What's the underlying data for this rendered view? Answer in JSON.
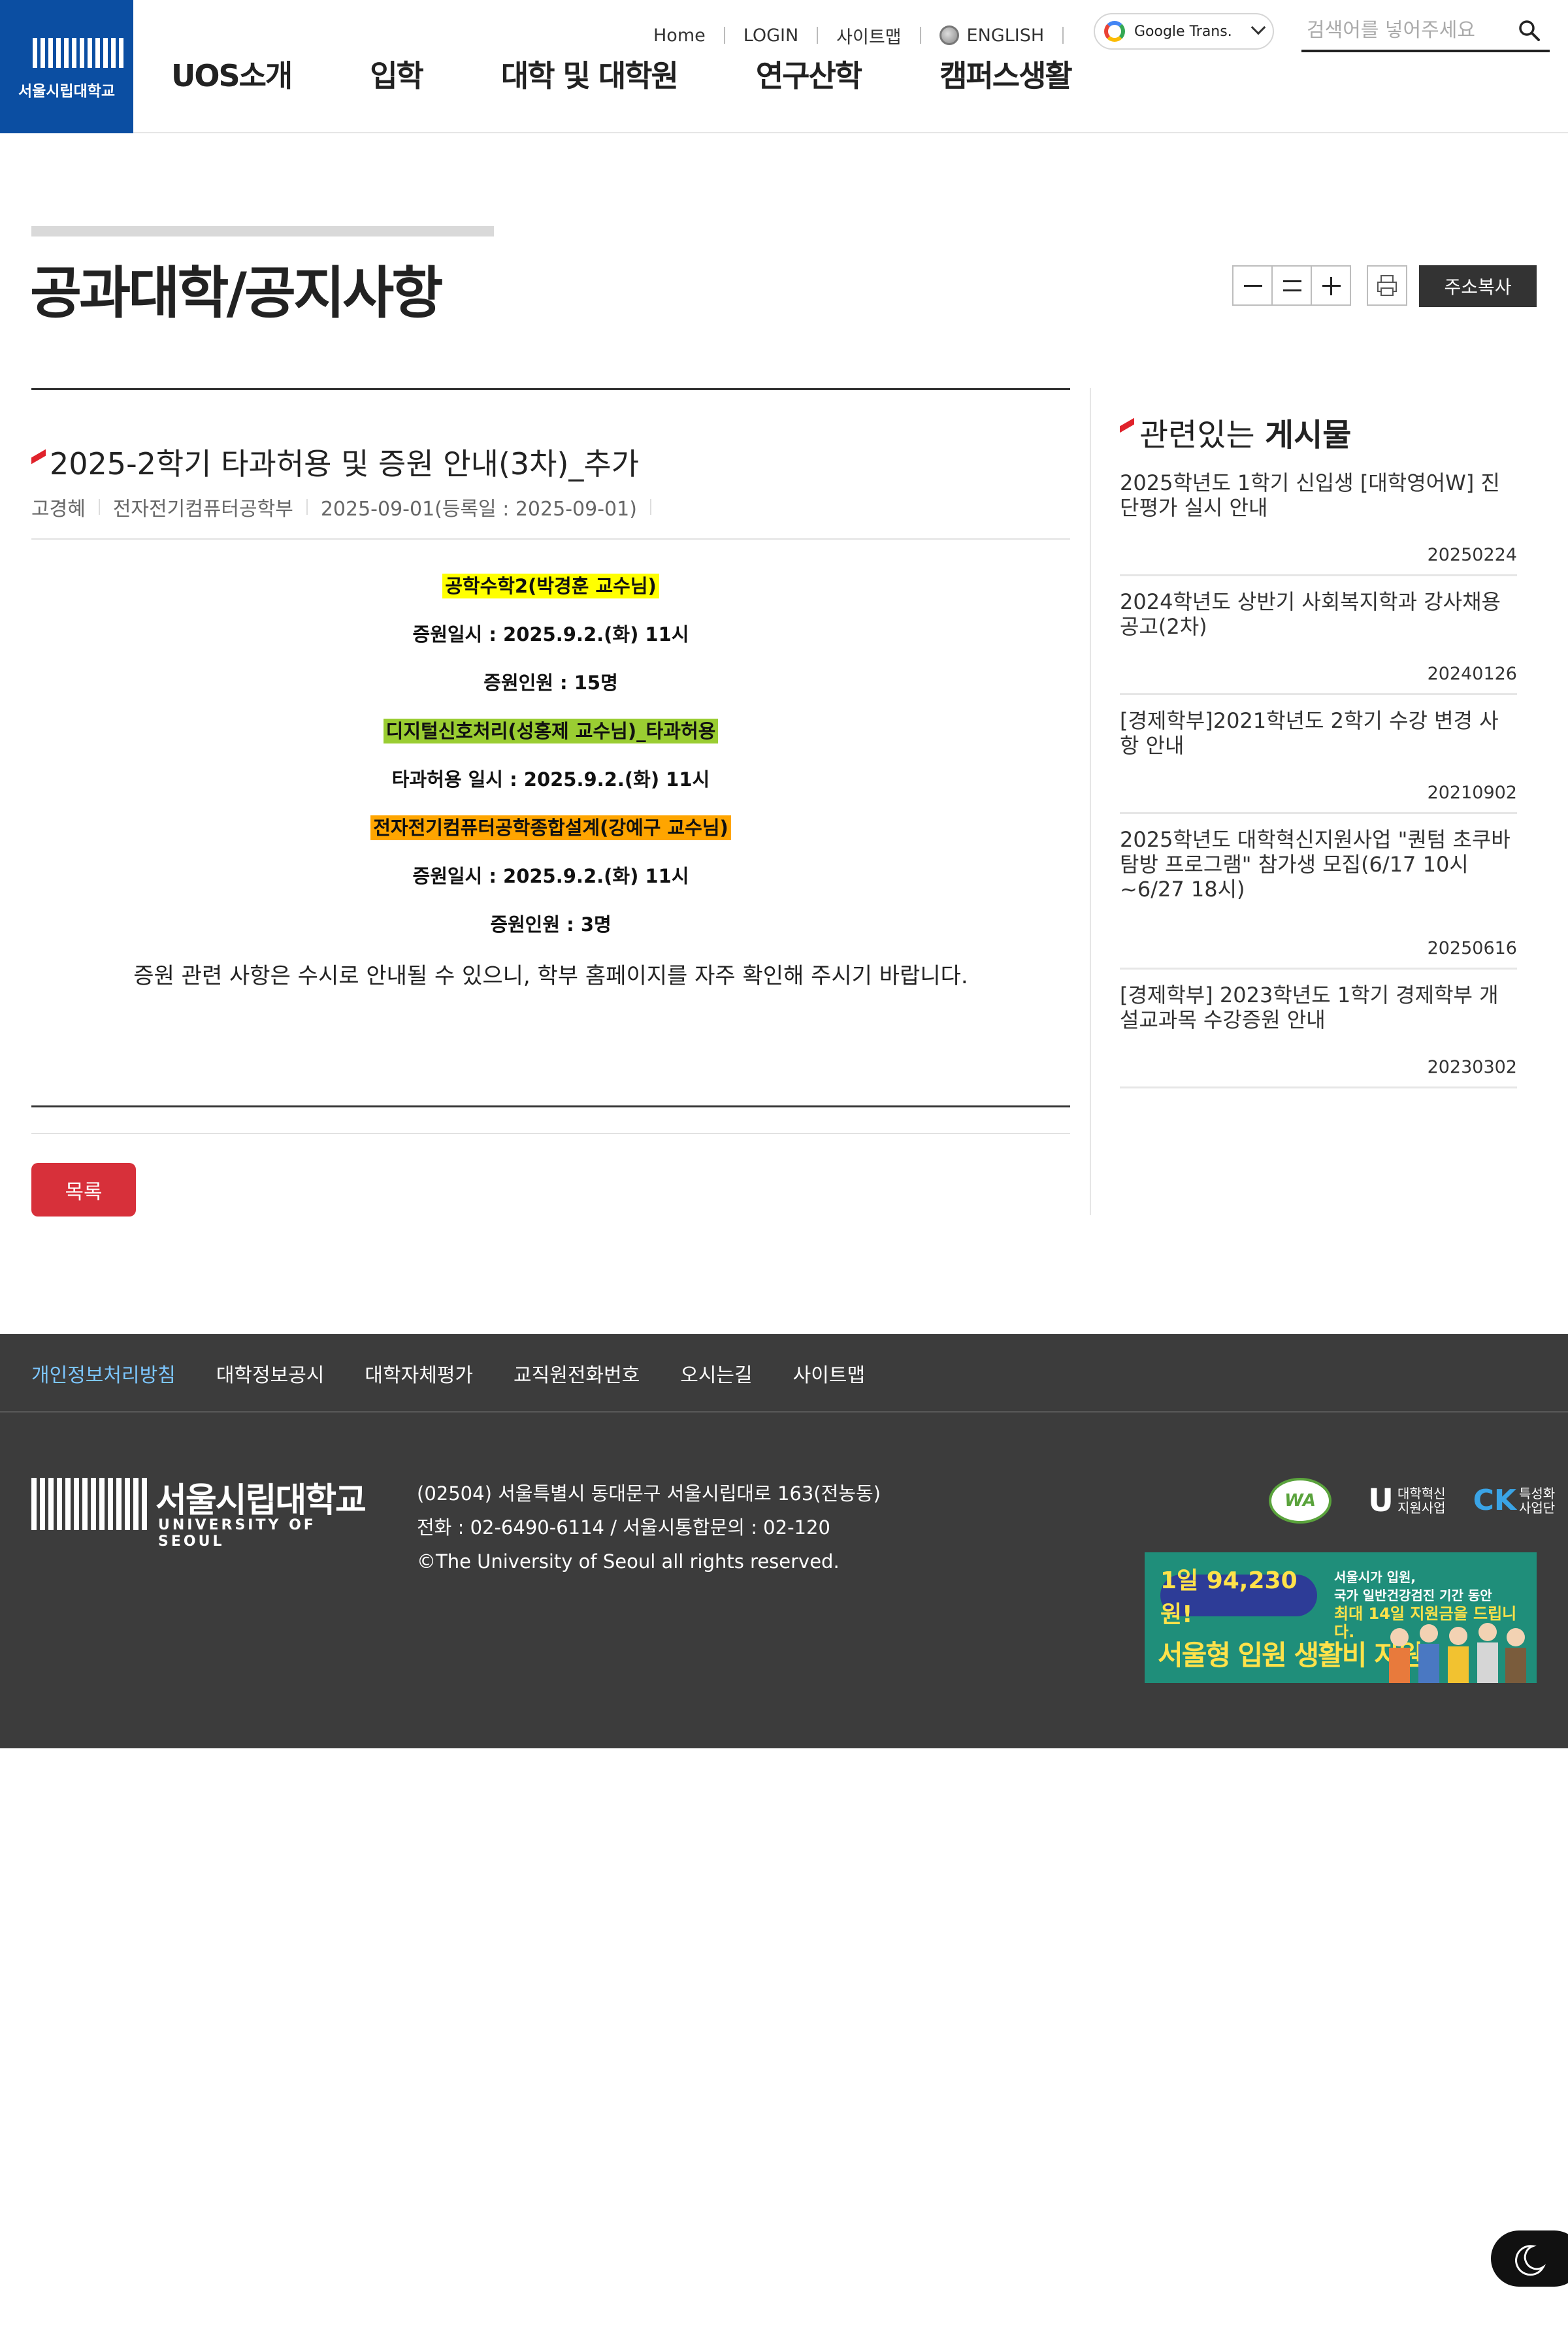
{
  "header": {
    "logo_text": "서울시립대학교",
    "gnb": [
      "UOS소개",
      "입학",
      "대학 및 대학원",
      "연구산학",
      "캠퍼스생활"
    ],
    "util": {
      "home": "Home",
      "login": "LOGIN",
      "sitemap": "사이트맵",
      "english": "ENGLISH"
    },
    "google_translate": "Google Trans.",
    "search": {
      "placeholder": "검색어를 넣어주세요"
    }
  },
  "page": {
    "title": "공과대학/공지사항",
    "copy_url_label": "주소복사",
    "tools": [
      "font-decrease",
      "font-reset",
      "font-increase",
      "print"
    ]
  },
  "article": {
    "title": "2025-2학기 타과허용 및 증원 안내(3차)_추가",
    "author": "고경혜",
    "department": "전자전기컴퓨터공학부",
    "date": "2025-09-01(등록일 : 2025-09-01)",
    "content": [
      {
        "text": "공학수학2(박경훈 교수님)",
        "highlight": "#ffff00"
      },
      {
        "text": "증원일시 : 2025.9.2.(화) 11시",
        "highlight": ""
      },
      {
        "text": "증원인원 : 15명",
        "highlight": ""
      },
      {
        "text": "디지털신호처리(성홍제 교수님)_타과허용",
        "highlight": "#9acd32"
      },
      {
        "text": "타과허용 일시 : 2025.9.2.(화) 11시",
        "highlight": ""
      },
      {
        "text": "전자전기컴퓨터공학종합설계(강예구 교수님)",
        "highlight": "#ffa500"
      },
      {
        "text": "증원일시 : 2025.9.2.(화) 11시",
        "highlight": ""
      },
      {
        "text": "증원인원 : 3명",
        "highlight": ""
      }
    ],
    "notice": "증원 관련 사항은 수시로 안내될 수 있으니, 학부 홈페이지를 자주 확인해 주시기 바랍니다.",
    "list_button": "목록"
  },
  "related": {
    "title_light": "관련있는",
    "title_bold": "게시물",
    "items": [
      {
        "title": "2025학년도 1학기 신입생 [대학영어W] 진단평가 실시 안내",
        "date": "20250224"
      },
      {
        "title": "2024학년도 상반기 사회복지학과 강사채용 공고(2차)",
        "date": "20240126"
      },
      {
        "title": "[경제학부]2021학년도 2학기 수강 변경 사항 안내",
        "date": "20210902"
      },
      {
        "title": "2025학년도 대학혁신지원사업 \"퀀텀 초쿠바 탐방 프로그램\" 참가생 모집(6/17 10시~6/27 18시)",
        "date": "20250616"
      },
      {
        "title": "[경제학부] 2023학년도 1학기 경제학부 개설교과목 수강증원 안내",
        "date": "20230302"
      }
    ]
  },
  "footer": {
    "links": [
      "개인정보처리방침",
      "대학정보공시",
      "대학자체평가",
      "교직원전화번호",
      "오시는길",
      "사이트맵"
    ],
    "logo_ko": "서울시립대학교",
    "logo_en": "UNIVERSITY OF SEOUL",
    "address": "(02504) 서울특별시 동대문구 서울시립대로 163(전농동)",
    "phone": "전화 : 02-6490-6114 / 서울시통합문의 : 02-120",
    "copyright": "©The University of Seoul all rights reserved.",
    "badges": {
      "wa": "WA",
      "u_label_1": "대학혁신",
      "u_label_2": "지원사업",
      "ck_label_1": "특성화",
      "ck_label_2": "사업단"
    },
    "banner": {
      "amount": "1일 94,230원!",
      "line1": "서울시가 입원,",
      "line2": "국가 일반건강검진 기간 동안",
      "line3": "최대 14일 지원금을 드립니다.",
      "headline": "서울형 입원 생활비 지원"
    }
  },
  "colors": {
    "brand_blue": "#0b4ea2",
    "accent_red": "#d7303a",
    "footer_bg": "#3c3c3c"
  }
}
